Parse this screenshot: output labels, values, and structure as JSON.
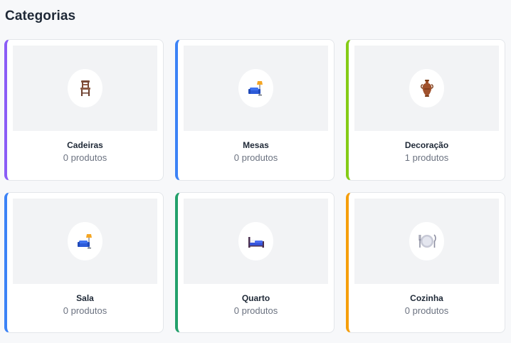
{
  "page": {
    "title": "Categorias"
  },
  "categories": [
    {
      "name": "Cadeiras",
      "count_label": "0 produtos",
      "icon": "chair-icon",
      "accent": "#8b5cf6"
    },
    {
      "name": "Mesas",
      "count_label": "0 produtos",
      "icon": "couch-lamp-icon",
      "accent": "#3b82f6"
    },
    {
      "name": "Decoração",
      "count_label": "1 produtos",
      "icon": "vase-icon",
      "accent": "#84cc16"
    },
    {
      "name": "Sala",
      "count_label": "0 produtos",
      "icon": "couch-lamp-icon",
      "accent": "#3b82f6"
    },
    {
      "name": "Quarto",
      "count_label": "0 produtos",
      "icon": "bed-icon",
      "accent": "#22a06b"
    },
    {
      "name": "Cozinha",
      "count_label": "0 produtos",
      "icon": "plate-icon",
      "accent": "#f59e0b"
    }
  ]
}
